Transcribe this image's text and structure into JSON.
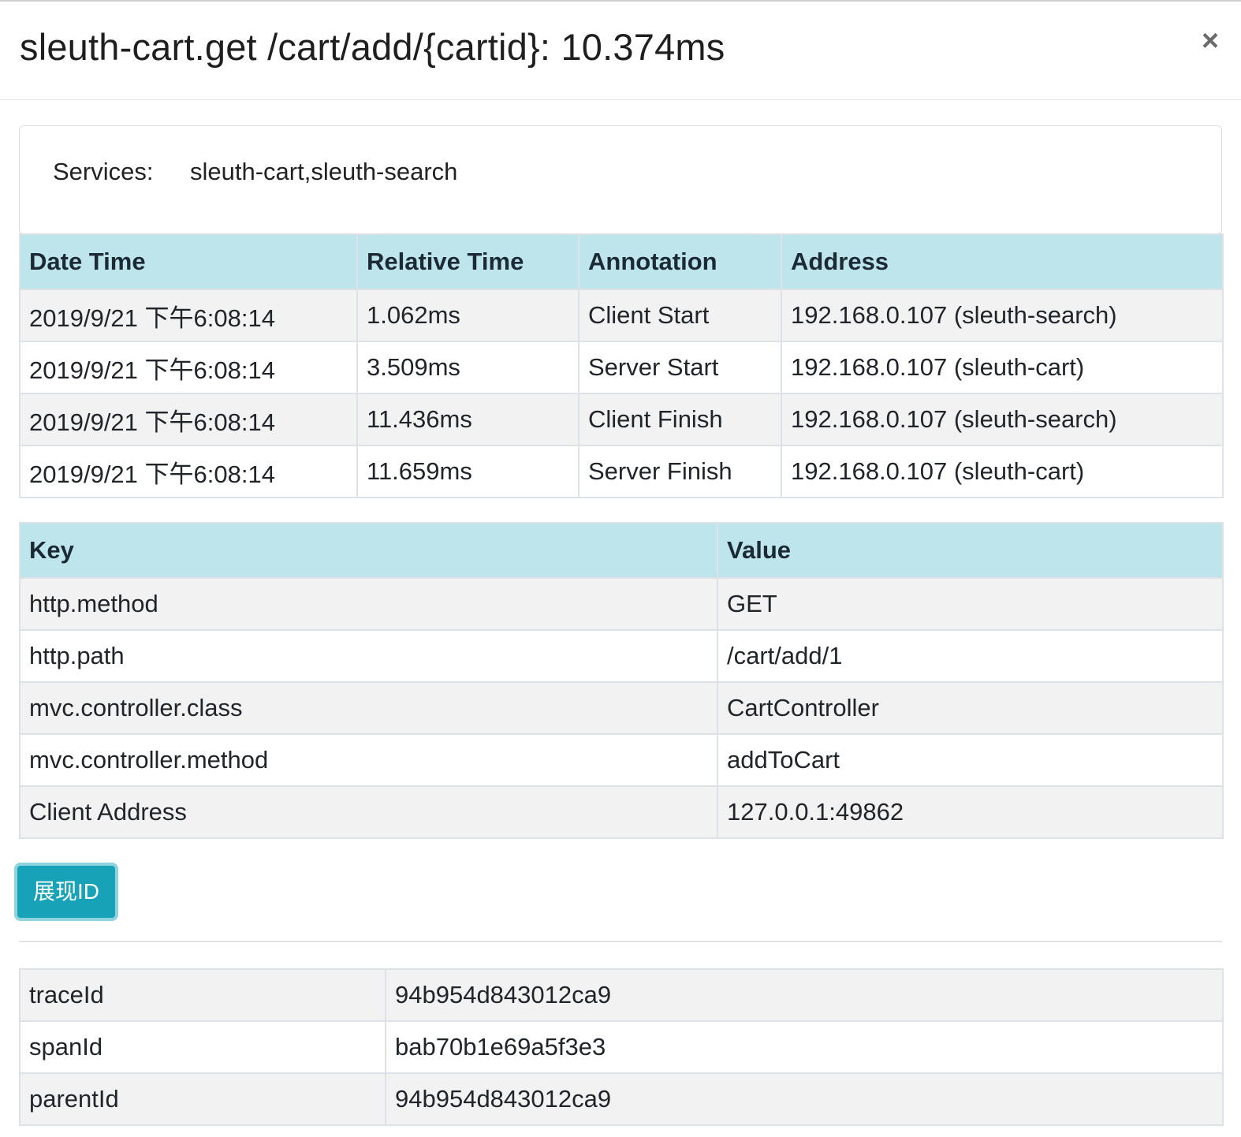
{
  "modal": {
    "title": "sleuth-cart.get /cart/add/{cartid}: 10.374ms",
    "close_glyph": "×",
    "close_icon": "close-icon"
  },
  "services": {
    "label": "Services:",
    "value": "sleuth-cart,sleuth-search"
  },
  "annotations": {
    "headers": [
      "Date Time",
      "Relative Time",
      "Annotation",
      "Address"
    ],
    "rows": [
      [
        "2019/9/21 下午6:08:14",
        "1.062ms",
        "Client Start",
        "192.168.0.107 (sleuth-search)"
      ],
      [
        "2019/9/21 下午6:08:14",
        "3.509ms",
        "Server Start",
        "192.168.0.107 (sleuth-cart)"
      ],
      [
        "2019/9/21 下午6:08:14",
        "11.436ms",
        "Client Finish",
        "192.168.0.107 (sleuth-search)"
      ],
      [
        "2019/9/21 下午6:08:14",
        "11.659ms",
        "Server Finish",
        "192.168.0.107 (sleuth-cart)"
      ]
    ]
  },
  "tags": {
    "headers": [
      "Key",
      "Value"
    ],
    "rows": [
      [
        "http.method",
        "GET"
      ],
      [
        "http.path",
        "/cart/add/1"
      ],
      [
        "mvc.controller.class",
        "CartController"
      ],
      [
        "mvc.controller.method",
        "addToCart"
      ],
      [
        "Client Address",
        "127.0.0.1:49862"
      ]
    ]
  },
  "show_id_button": {
    "label": "展现ID",
    "color": "#17a2b8"
  },
  "ids": {
    "rows": [
      [
        "traceId",
        "94b954d843012ca9"
      ],
      [
        "spanId",
        "bab70b1e69a5f3e3"
      ],
      [
        "parentId",
        "94b954d843012ca9"
      ]
    ]
  },
  "colors": {
    "header_bg": "#bee5eb",
    "stripe_bg": "#f2f2f2"
  }
}
